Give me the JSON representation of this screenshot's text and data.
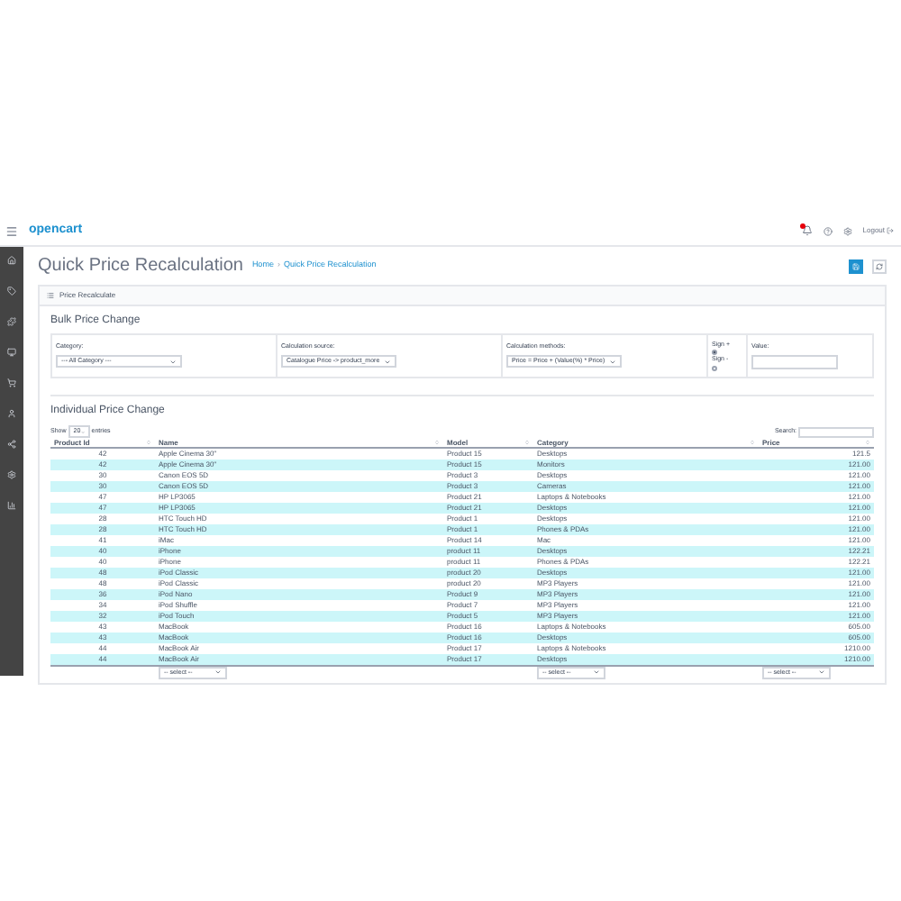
{
  "header": {
    "logo": "opencart",
    "logout": "Logout"
  },
  "page": {
    "title": "Quick Price Recalculation",
    "breadcrumb": [
      "Home",
      "Quick Price Recalculation"
    ],
    "breadcrumb_separator": "›"
  },
  "panel": {
    "title": "Price Recalculate"
  },
  "bulk": {
    "title": "Bulk Price Change",
    "category_label": "Category:",
    "category_value": "--- All Category ---",
    "source_label": "Calculation source:",
    "source_value": "Catalogue Price -> product_more",
    "method_label": "Calculation methods:",
    "method_value": "Price = Price + (Value(%) * Price)",
    "signs": [
      {
        "label": "Sign +",
        "selected": true
      },
      {
        "label": "Sign -",
        "selected": false
      }
    ],
    "value_label": "Value:"
  },
  "individual": {
    "title": "Individual Price Change",
    "show": "Show",
    "entries_value": "20",
    "entries": "entries",
    "search_label": "Search:"
  },
  "table": {
    "columns": [
      "Product Id",
      "Name",
      "Model",
      "Category",
      "Price"
    ],
    "rows": [
      [
        "42",
        "Apple Cinema 30\"",
        "Product 15",
        "Desktops",
        "121.5"
      ],
      [
        "42",
        "Apple Cinema 30\"",
        "Product 15",
        "Monitors",
        "121.00"
      ],
      [
        "30",
        "Canon EOS 5D",
        "Product 3",
        "Desktops",
        "121.00"
      ],
      [
        "30",
        "Canon EOS 5D",
        "Product 3",
        "Cameras",
        "121.00"
      ],
      [
        "47",
        "HP LP3065",
        "Product 21",
        "Laptops & Notebooks",
        "121.00"
      ],
      [
        "47",
        "HP LP3065",
        "Product 21",
        "Desktops",
        "121.00"
      ],
      [
        "28",
        "HTC Touch HD",
        "Product 1",
        "Desktops",
        "121.00"
      ],
      [
        "28",
        "HTC Touch HD",
        "Product 1",
        "Phones & PDAs",
        "121.00"
      ],
      [
        "41",
        "iMac",
        "Product 14",
        "Mac",
        "121.00"
      ],
      [
        "40",
        "iPhone",
        "product 11",
        "Desktops",
        "122.21"
      ],
      [
        "40",
        "iPhone",
        "product 11",
        "Phones & PDAs",
        "122.21"
      ],
      [
        "48",
        "iPod Classic",
        "product 20",
        "Desktops",
        "121.00"
      ],
      [
        "48",
        "iPod Classic",
        "product 20",
        "MP3 Players",
        "121.00"
      ],
      [
        "36",
        "iPod Nano",
        "Product 9",
        "MP3 Players",
        "121.00"
      ],
      [
        "34",
        "iPod Shuffle",
        "Product 7",
        "MP3 Players",
        "121.00"
      ],
      [
        "32",
        "iPod Touch",
        "Product 5",
        "MP3 Players",
        "121.00"
      ],
      [
        "43",
        "MacBook",
        "Product 16",
        "Laptops & Notebooks",
        "605.00"
      ],
      [
        "43",
        "MacBook",
        "Product 16",
        "Desktops",
        "605.00"
      ],
      [
        "44",
        "MacBook Air",
        "Product 17",
        "Laptops & Notebooks",
        "1210.00"
      ],
      [
        "44",
        "MacBook Air",
        "Product 17",
        "Desktops",
        "1210.00"
      ]
    ],
    "column_filters": {
      "name": "-- select --",
      "category": "-- select --",
      "price": "-- select --"
    }
  }
}
